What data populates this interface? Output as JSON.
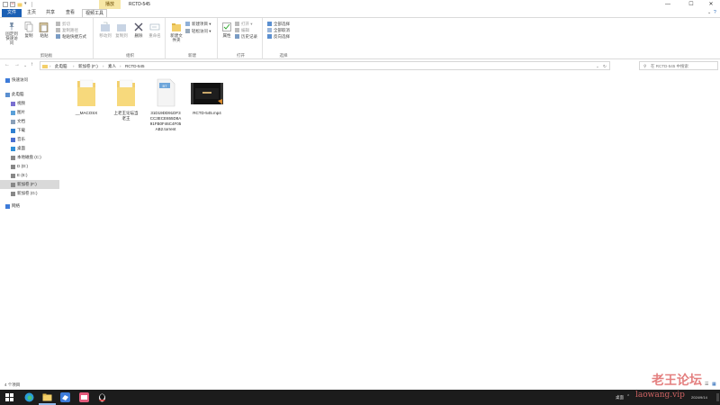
{
  "window": {
    "title": "RCTD-545",
    "manage_tab": "播放",
    "controls": {
      "minimize": "—",
      "maximize": "☐",
      "close": "✕"
    }
  },
  "ribbon_tabs": [
    "文件",
    "主页",
    "共享",
    "查看",
    "视频工具"
  ],
  "ribbon": {
    "clipboard": {
      "label": "剪贴板",
      "pin": "固定到快速访问",
      "copy": "复制",
      "paste": "粘贴",
      "cut": "剪切",
      "copy_path": "复制路径",
      "paste_shortcut": "粘贴快捷方式"
    },
    "organize": {
      "label": "组织",
      "move_to": "移动到",
      "copy_to": "复制到",
      "delete": "删除",
      "rename": "重命名"
    },
    "new": {
      "label": "新建",
      "new_folder": "新建文件夹",
      "new_item": "新建项目 ▾",
      "easy_access": "轻松访问 ▾"
    },
    "open": {
      "label": "打开",
      "properties": "属性",
      "open": "打开 ▾",
      "edit": "编辑",
      "history": "历史记录"
    },
    "select": {
      "label": "选择",
      "select_all": "全部选择",
      "select_none": "全部取消",
      "invert": "反向选择"
    }
  },
  "address": {
    "crumbs": [
      "此电脑",
      "新加卷 (F:)",
      "素人",
      "RCTD-545"
    ],
    "search_placeholder": "在 RCTD-545 中搜索"
  },
  "nav_pane": [
    {
      "label": "快速访问",
      "icon": "star-icon",
      "indent": 0
    },
    {
      "label": "此电脑",
      "icon": "pc-icon",
      "indent": 0
    },
    {
      "label": "视频",
      "icon": "video-folder-icon",
      "indent": 1
    },
    {
      "label": "图片",
      "icon": "pictures-folder-icon",
      "indent": 1
    },
    {
      "label": "文档",
      "icon": "documents-folder-icon",
      "indent": 1
    },
    {
      "label": "下载",
      "icon": "download-icon",
      "indent": 1
    },
    {
      "label": "音乐",
      "icon": "music-icon",
      "indent": 1
    },
    {
      "label": "桌面",
      "icon": "desktop-icon",
      "indent": 1
    },
    {
      "label": "本地磁盘 (C:)",
      "icon": "drive-icon",
      "indent": 1
    },
    {
      "label": "D (D:)",
      "icon": "drive-icon",
      "indent": 1
    },
    {
      "label": "E (E:)",
      "icon": "drive-icon",
      "indent": 1
    },
    {
      "label": "新加卷 (F:)",
      "icon": "drive-icon",
      "indent": 1,
      "selected": true
    },
    {
      "label": "新加卷 (G:)",
      "icon": "drive-icon",
      "indent": 1
    },
    {
      "label": "网络",
      "icon": "network-icon",
      "indent": 0
    }
  ],
  "files": [
    {
      "name": "__MACOSX",
      "kind": "folder"
    },
    {
      "name": "上老王论坛当老王",
      "kind": "folder"
    },
    {
      "name": "31D19DD91DF3CC3ECE655D8A91FB0F46C4F05AB2.torrent",
      "kind": "torrent",
      "badge": "BT"
    },
    {
      "name": "RCTD-545.mp4",
      "kind": "video"
    }
  ],
  "status": "4 个项目",
  "taskbar": {
    "tray_text": "桌面",
    "date": "2024/9/14"
  },
  "watermark": {
    "line1": "老王论坛",
    "line2": "laowang.vip"
  },
  "colors": {
    "accent": "#1a5fb4",
    "manage_tab": "#f7e7a6",
    "folder": "#f3cf6a",
    "taskbar": "#1c1c1c",
    "watermark": "#e06a6a"
  }
}
